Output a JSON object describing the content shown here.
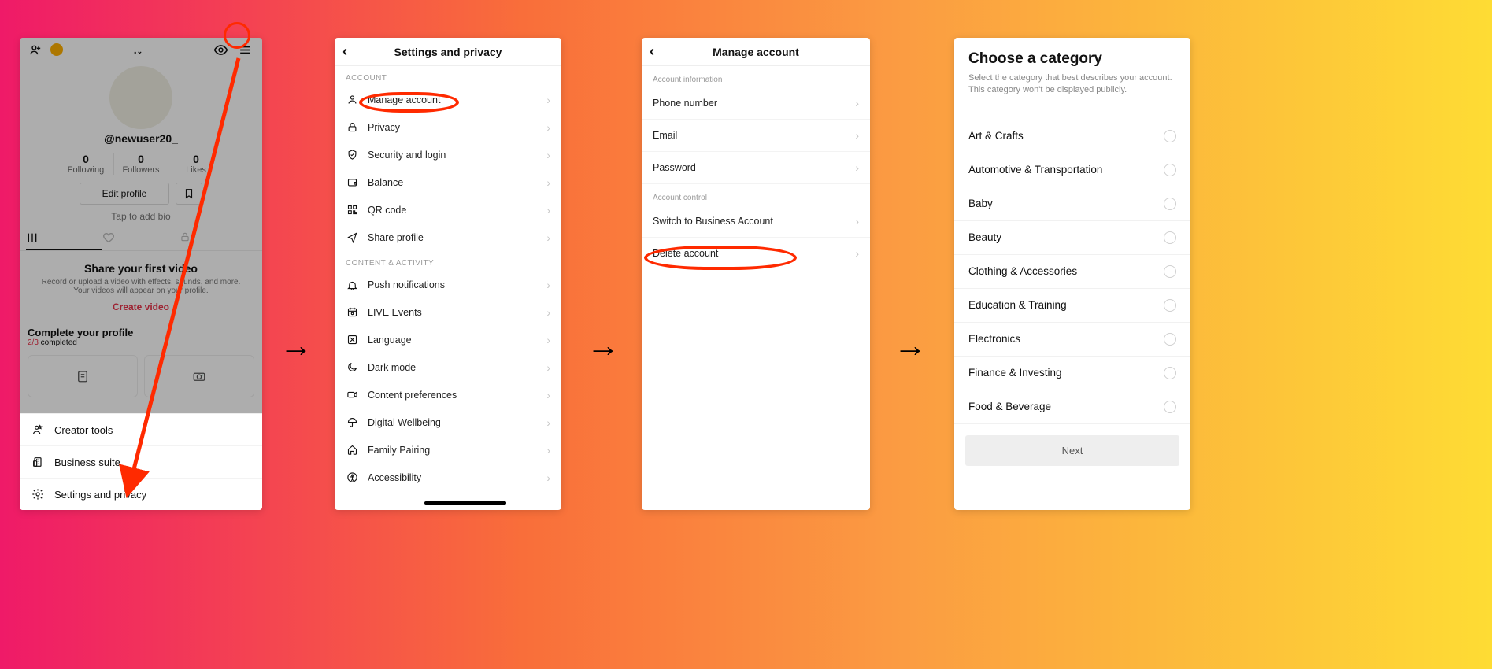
{
  "profile": {
    "username": "@newuser20_",
    "name_dropdown": ".",
    "stats": {
      "following": {
        "n": "0",
        "l": "Following"
      },
      "followers": {
        "n": "0",
        "l": "Followers"
      },
      "likes": {
        "n": "0",
        "l": "Likes"
      }
    },
    "edit_profile": "Edit profile",
    "tap_bio": "Tap to add bio",
    "share_heading": "Share your first video",
    "share_sub": "Record or upload a video with effects, sounds, and more. Your videos will appear on your profile.",
    "create_video": "Create video",
    "complete_heading": "Complete your profile",
    "complete_count_red": "2/3",
    "complete_count_rest": " completed",
    "sheet": {
      "creator_tools": "Creator tools",
      "business_suite": "Business suite",
      "settings_privacy": "Settings and privacy"
    }
  },
  "settings": {
    "title": "Settings and privacy",
    "section_account": "ACCOUNT",
    "items_account": {
      "manage_account": "Manage account",
      "privacy": "Privacy",
      "security_login": "Security and login",
      "balance": "Balance",
      "qr_code": "QR code",
      "share_profile": "Share profile"
    },
    "section_content": "CONTENT & ACTIVITY",
    "items_content": {
      "push_notifications": "Push notifications",
      "live_events": "LIVE Events",
      "language": "Language",
      "dark_mode": "Dark mode",
      "content_preferences": "Content preferences",
      "digital_wellbeing": "Digital Wellbeing",
      "family_pairing": "Family Pairing",
      "accessibility": "Accessibility"
    }
  },
  "manage": {
    "title": "Manage account",
    "section_info": "Account information",
    "phone": "Phone number",
    "email": "Email",
    "password": "Password",
    "section_control": "Account control",
    "switch_business": "Switch to Business Account",
    "delete_account": "Delete account"
  },
  "category": {
    "title": "Choose a category",
    "subtitle": "Select the category that best describes your account. This category won't be displayed publicly.",
    "items": [
      "Art & Crafts",
      "Automotive & Transportation",
      "Baby",
      "Beauty",
      "Clothing & Accessories",
      "Education & Training",
      "Electronics",
      "Finance & Investing",
      "Food & Beverage"
    ],
    "next": "Next"
  }
}
